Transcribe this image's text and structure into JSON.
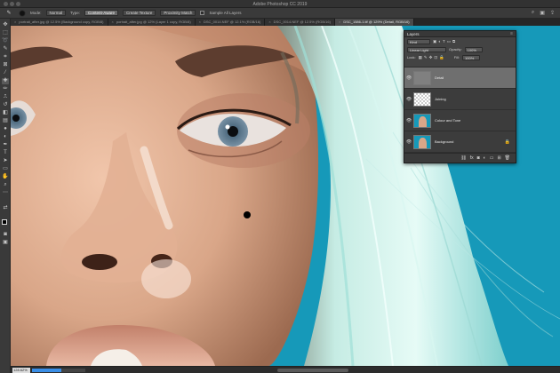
{
  "window": {
    "title": "Adobe Photoshop CC 2019"
  },
  "options_bar": {
    "tool_icon": "brush-tool-icon",
    "mode_label": "Mode:",
    "mode_value": "Normal",
    "type_label": "Type:",
    "buttons": [
      "Content-Aware",
      "Create Texture",
      "Proximity Match"
    ],
    "sample_all_layers": "Sample All Layers"
  },
  "tabs": [
    {
      "label": "portrait_after.jpg @ 12.5% (Background copy, RGB/8)",
      "active": false
    },
    {
      "label": "portrait_after.jpg @ 12% (Layer 1 copy, RGB/8)",
      "active": false
    },
    {
      "label": "DSC_0014.NEF @ 12.1% (RGB/16)",
      "active": false
    },
    {
      "label": "DSC_0014.NEF @ 12.5% (RGB/16)",
      "active": false
    },
    {
      "label": "DSC_1586-1.tif @ 129% (Detail, RGB/16)",
      "active": true
    }
  ],
  "layers_panel": {
    "title": "Layers",
    "filter_value": "Kind",
    "blend_mode": "Linear Light",
    "opacity_label": "Opacity:",
    "opacity_value": "100%",
    "lock_label": "Lock:",
    "fill_label": "Fill:",
    "fill_value": "100%",
    "layers": [
      {
        "name": "Detail",
        "thumb": "gray",
        "selected": true
      },
      {
        "name": "Joining",
        "thumb": "check",
        "selected": false
      },
      {
        "name": "Colour and Tone",
        "thumb": "photo",
        "selected": false
      },
      {
        "name": "Background",
        "thumb": "photo",
        "selected": false,
        "locked": true
      }
    ]
  },
  "status": {
    "zoom": "128.62%",
    "progress": 0.55
  },
  "colors": {
    "canvas_bg": "#1699b9",
    "skin": "#d9a688",
    "hair": "#c8efe9"
  }
}
